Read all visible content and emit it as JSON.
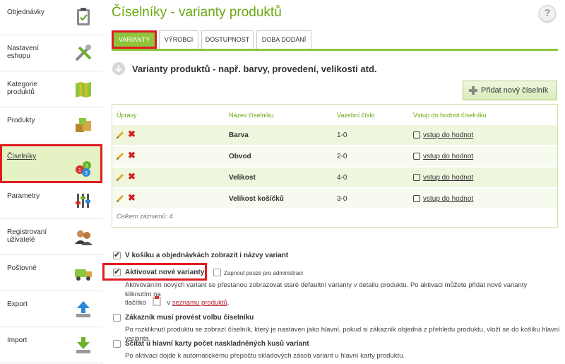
{
  "sidebar": {
    "items": [
      {
        "label": "Objednávky",
        "icon": "clipboard-icon"
      },
      {
        "label": "Nastavení eshopu",
        "icon": "tools-icon"
      },
      {
        "label": "Kategorie produktů",
        "icon": "map-folder-icon"
      },
      {
        "label": "Produkty",
        "icon": "boxes-icon"
      },
      {
        "label": "Číselníky",
        "icon": "numbers-icon"
      },
      {
        "label": "Parametry",
        "icon": "sliders-icon"
      },
      {
        "label": "Registrovaní uživatelé",
        "icon": "users-icon"
      },
      {
        "label": "Poštovné",
        "icon": "truck-icon"
      },
      {
        "label": "Export",
        "icon": "upload-icon"
      },
      {
        "label": "Import",
        "icon": "download-icon"
      }
    ],
    "active_index": 4
  },
  "header": {
    "title": "Číselníky - varianty produktů",
    "help": "?"
  },
  "tabs": [
    {
      "label": "VARIANTY",
      "active": true
    },
    {
      "label": "VÝROBCI",
      "active": false
    },
    {
      "label": "DOSTUPNOST",
      "active": false
    },
    {
      "label": "DOBA DODÁNÍ",
      "active": false
    }
  ],
  "subtitle": "Varianty produktů - např. barvy, provedení, velikosti atd.",
  "add_button": "Přidat nový číselník",
  "table": {
    "headers": [
      "Úpravy",
      "Název číselníku",
      "Vazební číslo",
      "Vstup do hodnot číselníku"
    ],
    "rows": [
      {
        "name": "Barva",
        "code": "1-0",
        "link": "vstup do hodnot"
      },
      {
        "name": "Obvod",
        "code": "2-0",
        "link": "vstup do hodnot"
      },
      {
        "name": "Velikost",
        "code": "4-0",
        "link": "vstup do hodnot"
      },
      {
        "name": "Velikost košíčků",
        "code": "3-0",
        "link": "vstup do hodnot"
      }
    ],
    "total": "Celkem záznamů: 4"
  },
  "options": {
    "show_names": {
      "label": "V košíku a objednávkách zobrazit i názvy variant",
      "checked": true
    },
    "activate": {
      "label": "Aktivovat nové varianty",
      "checked": true,
      "admin_only": "Zapnout pouze pro administraci",
      "desc1": "Aktivováním nových variant se přestanou zobrazovat staré defaultní varianty v detailu produktu. Po aktivaci můžete přidat nové varianty kliknutím na",
      "desc2_pre": "tlačítko",
      "desc2_mid": "v",
      "desc2_link": "seznamu produktů",
      "desc2_post": "."
    },
    "must_choose": {
      "label": "Zákazník musí provést volbu číselníku",
      "checked": false,
      "desc": "Po rozkliknutí produktu se zobrazí číselník, který je nastaven jako hlavní, pokud si zákazník objedná z přehledu produktu, vloží se do košíku hlavní varianta."
    },
    "sum_stock": {
      "label": "Sčítat u hlavní karty počet naskladněných kusů variant",
      "checked": false,
      "desc": "Po aktivaci dojde k automatickému přepočtu skladových zásob variant u hlavní karty produktu."
    }
  },
  "colors": {
    "accent": "#8fc43b",
    "title": "#6aa80e",
    "highlight": "#e11b22"
  }
}
